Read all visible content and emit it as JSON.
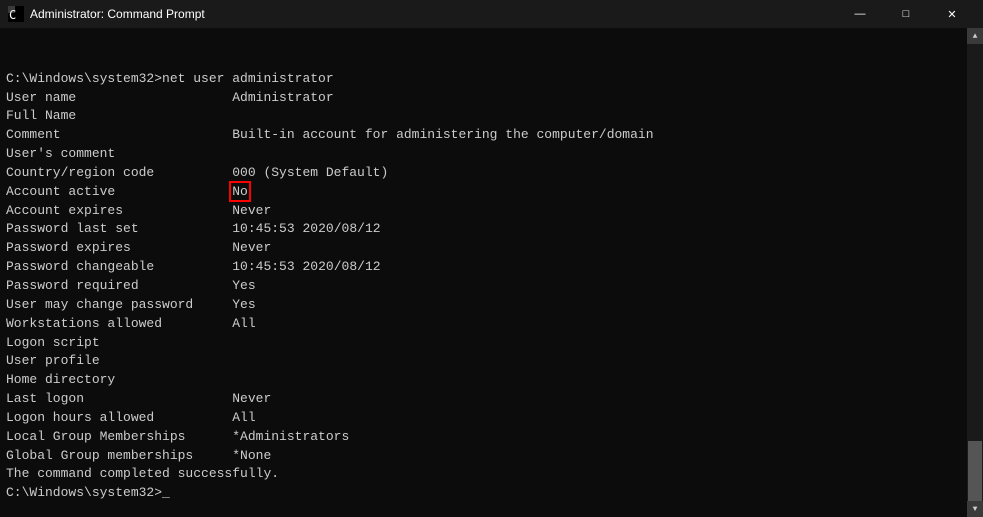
{
  "window": {
    "title": "Administrator: Command Prompt",
    "icon": "cmd-icon"
  },
  "titlebar": {
    "minimize_label": "—",
    "maximize_label": "□",
    "close_label": "✕"
  },
  "console": {
    "lines": [
      {
        "id": "cmd-input",
        "text": "C:\\Windows\\system32>net user administrator",
        "highlight": false
      },
      {
        "id": "user-name",
        "text": "User name                    Administrator",
        "highlight": false
      },
      {
        "id": "full-name",
        "text": "Full Name",
        "highlight": false
      },
      {
        "id": "comment",
        "text": "Comment                      Built-in account for administering the computer/domain",
        "highlight": false
      },
      {
        "id": "users-comment",
        "text": "User's comment",
        "highlight": false
      },
      {
        "id": "country-code",
        "text": "Country/region code          000 (System Default)",
        "highlight": false
      },
      {
        "id": "account-active",
        "text": "Account active               No",
        "highlight": true
      },
      {
        "id": "account-expires",
        "text": "Account expires              Never",
        "highlight": false
      },
      {
        "id": "blank1",
        "text": "",
        "highlight": false
      },
      {
        "id": "pwd-last-set",
        "text": "Password last set            ‏12/‏08/‏2020 10:45:53",
        "highlight": false
      },
      {
        "id": "pwd-expires",
        "text": "Password expires             Never",
        "highlight": false
      },
      {
        "id": "pwd-changeable",
        "text": "Password changeable          ‏12/‏08/‏2020 10:45:53",
        "highlight": false
      },
      {
        "id": "pwd-required",
        "text": "Password required            Yes",
        "highlight": false
      },
      {
        "id": "user-may-change",
        "text": "User may change password     Yes",
        "highlight": false
      },
      {
        "id": "blank2",
        "text": "",
        "highlight": false
      },
      {
        "id": "workstations",
        "text": "Workstations allowed         All",
        "highlight": false
      },
      {
        "id": "logon-script",
        "text": "Logon script",
        "highlight": false
      },
      {
        "id": "user-profile",
        "text": "User profile",
        "highlight": false
      },
      {
        "id": "home-dir",
        "text": "Home directory",
        "highlight": false
      },
      {
        "id": "last-logon",
        "text": "Last logon                   Never",
        "highlight": false
      },
      {
        "id": "blank3",
        "text": "",
        "highlight": false
      },
      {
        "id": "logon-hours",
        "text": "Logon hours allowed          All",
        "highlight": false
      },
      {
        "id": "blank4",
        "text": "",
        "highlight": false
      },
      {
        "id": "local-group",
        "text": "Local Group Memberships      *Administrators",
        "highlight": false
      },
      {
        "id": "global-group",
        "text": "Global Group memberships     *None",
        "highlight": false
      },
      {
        "id": "completed",
        "text": "The command completed successfully.",
        "highlight": false
      },
      {
        "id": "blank5",
        "text": "",
        "highlight": false
      },
      {
        "id": "prompt",
        "text": "C:\\Windows\\system32>_",
        "highlight": false
      }
    ]
  }
}
